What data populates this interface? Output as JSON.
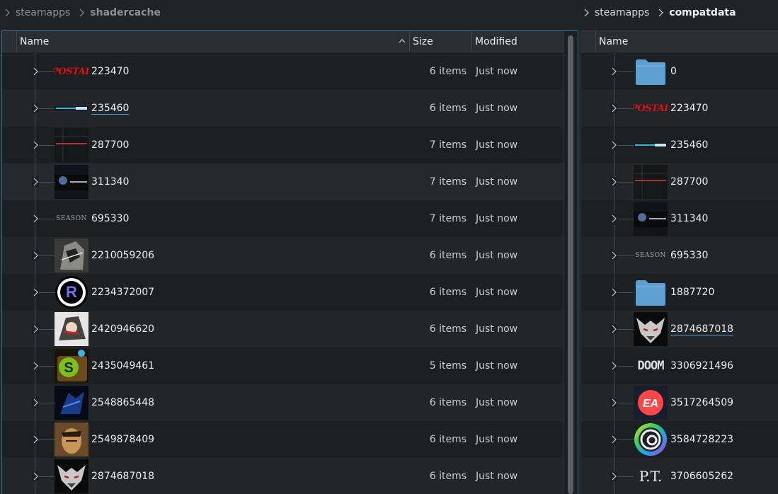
{
  "left_breadcrumb": [
    "steamapps",
    "shadercache"
  ],
  "right_breadcrumb": [
    "steamapps",
    "compatdata"
  ],
  "left_pane": {
    "columns": {
      "name": "Name",
      "size": "Size",
      "modified": "Modified"
    },
    "rows": [
      {
        "name": "223470",
        "size": "6 items",
        "modified": "Just now",
        "icon": "postal-icon"
      },
      {
        "name": "235460",
        "size": "6 items",
        "modified": "Just now",
        "icon": "metal-gear-rising-icon"
      },
      {
        "name": "287700",
        "size": "7 items",
        "modified": "Just now",
        "icon": "phantom-pain-icon"
      },
      {
        "name": "311340",
        "size": "7 items",
        "modified": "Just now",
        "icon": "mgs-collection-icon"
      },
      {
        "name": "695330",
        "size": "7 items",
        "modified": "Just now",
        "icon": "season-icon"
      },
      {
        "name": "2210059206",
        "size": "6 items",
        "modified": "Just now",
        "icon": "armored-figure-icon"
      },
      {
        "name": "2234372007",
        "size": "6 items",
        "modified": "Just now",
        "icon": "r-logo-icon"
      },
      {
        "name": "2420946620",
        "size": "6 items",
        "modified": "Just now",
        "icon": "anime-character-icon"
      },
      {
        "name": "2435049461",
        "size": "5 items",
        "modified": "Just now",
        "icon": "green-s-icon"
      },
      {
        "name": "2548865448",
        "size": "6 items",
        "modified": "Just now",
        "icon": "blue-figure-icon"
      },
      {
        "name": "2549878409",
        "size": "6 items",
        "modified": "Just now",
        "icon": "sepia-portrait-icon"
      },
      {
        "name": "2874687018",
        "size": "6 items",
        "modified": "Just now",
        "icon": "witcher-wolf-icon"
      }
    ]
  },
  "right_pane": {
    "columns": {
      "name": "Name"
    },
    "rows": [
      {
        "name": "0",
        "icon": "folder-icon"
      },
      {
        "name": "223470",
        "icon": "postal-icon"
      },
      {
        "name": "235460",
        "icon": "metal-gear-rising-icon"
      },
      {
        "name": "287700",
        "icon": "phantom-pain-icon"
      },
      {
        "name": "311340",
        "icon": "mgs-collection-icon"
      },
      {
        "name": "695330",
        "icon": "season-icon"
      },
      {
        "name": "1887720",
        "icon": "folder-icon"
      },
      {
        "name": "2874687018",
        "icon": "witcher-wolf-icon"
      },
      {
        "name": "3306921496",
        "icon": "doom-icon"
      },
      {
        "name": "3517264509",
        "icon": "ea-icon"
      },
      {
        "name": "3584728223",
        "icon": "ubisoft-icon"
      },
      {
        "name": "3706605262",
        "icon": "pt-icon"
      }
    ]
  },
  "thumb_text": {
    "postal": "POSTAL",
    "season": "SEASON",
    "doom": "DOOM",
    "pt": "P.T.",
    "ea": "EA",
    "r": "R"
  },
  "colors": {
    "accent": "#3a6f9a",
    "folder": "#5fa0d3",
    "postal_red": "#d11111"
  }
}
